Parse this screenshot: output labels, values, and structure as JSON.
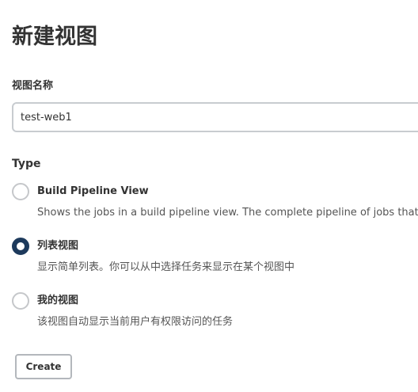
{
  "page": {
    "title": "新建视图"
  },
  "view_name": {
    "label": "视图名称",
    "value": "test-web1"
  },
  "type_section": {
    "label": "Type",
    "options": [
      {
        "title": "Build Pipeline View",
        "description": "Shows the jobs in a build pipeline view. The complete pipeline of jobs that a version propagates through are shown as a row in the view.",
        "selected": false
      },
      {
        "title": "列表视图",
        "description": "显示简单列表。你可以从中选择任务来显示在某个视图中",
        "selected": true
      },
      {
        "title": "我的视图",
        "description": "该视图自动显示当前用户有权限访问的任务",
        "selected": false
      }
    ]
  },
  "actions": {
    "create_label": "Create"
  },
  "colors": {
    "selected_radio": "#1d3a5c",
    "border": "#c8ccd0"
  }
}
